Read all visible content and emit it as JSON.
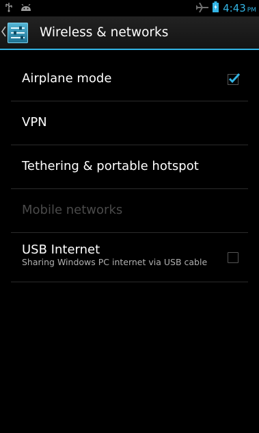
{
  "status_bar": {
    "left_icons": [
      "usb-icon",
      "android-icon"
    ],
    "right_icons": [
      "airplane-mode-icon",
      "battery-icon"
    ],
    "time": "4:43",
    "ampm": "PM",
    "accent_color": "#33b5e5"
  },
  "action_bar": {
    "up_icon": "chevron-left-icon",
    "app_icon": "settings-sliders-icon",
    "title": "Wireless & networks"
  },
  "preferences": [
    {
      "title": "Airplane mode",
      "checkbox": true,
      "checked": true,
      "enabled": true
    },
    {
      "title": "VPN",
      "checkbox": false,
      "enabled": true
    },
    {
      "title": "Tethering & portable hotspot",
      "checkbox": false,
      "enabled": true
    },
    {
      "title": "Mobile networks",
      "checkbox": false,
      "enabled": false
    },
    {
      "title": "USB Internet",
      "summary": "Sharing Windows PC internet via USB cable",
      "checkbox": true,
      "checked": false,
      "enabled": true
    }
  ]
}
